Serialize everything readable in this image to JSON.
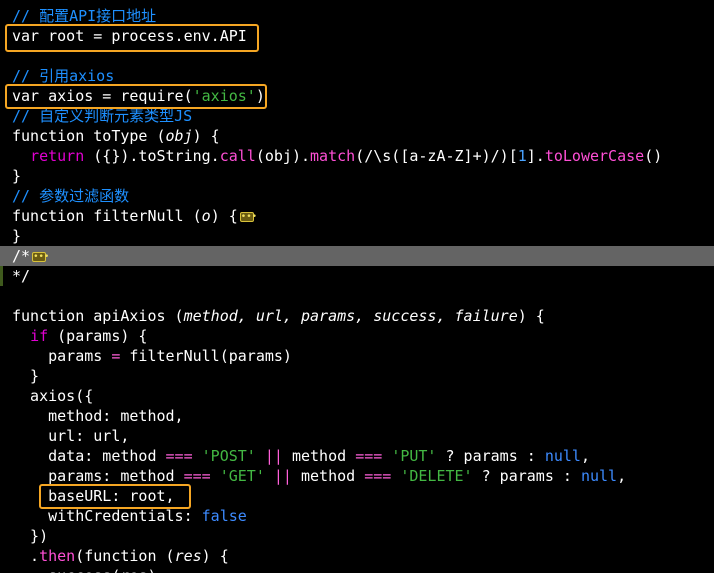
{
  "editor": {
    "lines": [
      {
        "tokens": [
          {
            "t": "// 配置API接口地址",
            "c": "cmt"
          }
        ]
      },
      {
        "tokens": [
          {
            "t": "var root = process.env.API",
            "c": ""
          }
        ]
      },
      {
        "tokens": []
      },
      {
        "tokens": [
          {
            "t": "// 引用axios",
            "c": "cmt"
          }
        ]
      },
      {
        "tokens": [
          {
            "t": "var axios = require(",
            "c": ""
          },
          {
            "t": "'axios'",
            "c": "str"
          },
          {
            "t": ")",
            "c": ""
          }
        ]
      },
      {
        "tokens": [
          {
            "t": "// 自定义判断元素类型JS",
            "c": "cmt"
          }
        ]
      },
      {
        "tokens": [
          {
            "t": "function toType (",
            "c": ""
          },
          {
            "t": "obj",
            "c": "prm"
          },
          {
            "t": ") {",
            "c": ""
          }
        ]
      },
      {
        "tokens": [
          {
            "t": "  ",
            "c": ""
          },
          {
            "t": "return",
            "c": "kw"
          },
          {
            "t": " ({}).toString.",
            "c": ""
          },
          {
            "t": "call",
            "c": "fn"
          },
          {
            "t": "(obj).",
            "c": ""
          },
          {
            "t": "match",
            "c": "fn"
          },
          {
            "t": "(/\\s([a-zA-Z]+)/)[",
            "c": ""
          },
          {
            "t": "1",
            "c": "num"
          },
          {
            "t": "].",
            "c": ""
          },
          {
            "t": "toLowerCase",
            "c": "fn"
          },
          {
            "t": "()",
            "c": ""
          }
        ]
      },
      {
        "tokens": [
          {
            "t": "}",
            "c": ""
          }
        ]
      },
      {
        "tokens": [
          {
            "t": "// 参数过滤函数",
            "c": "cmt"
          }
        ]
      },
      {
        "tokens": [
          {
            "t": "function filterNull (",
            "c": ""
          },
          {
            "t": "o",
            "c": "prm"
          },
          {
            "t": ") {",
            "c": ""
          },
          {
            "t": "fold",
            "c": "fold"
          }
        ]
      },
      {
        "tokens": [
          {
            "t": "}",
            "c": ""
          }
        ]
      },
      {
        "tokens": [
          {
            "t": "/*",
            "c": ""
          },
          {
            "t": "fold",
            "c": "fold"
          }
        ]
      },
      {
        "tokens": [
          {
            "t": "*/",
            "c": ""
          }
        ]
      },
      {
        "tokens": []
      },
      {
        "tokens": [
          {
            "t": "function apiAxios (",
            "c": ""
          },
          {
            "t": "method, url, params, success, failure",
            "c": "prm"
          },
          {
            "t": ") {",
            "c": ""
          }
        ]
      },
      {
        "tokens": [
          {
            "t": "  ",
            "c": ""
          },
          {
            "t": "if",
            "c": "kw"
          },
          {
            "t": " (params) {",
            "c": ""
          }
        ]
      },
      {
        "tokens": [
          {
            "t": "    params ",
            "c": ""
          },
          {
            "t": "=",
            "c": "op"
          },
          {
            "t": " filterNull(params)",
            "c": ""
          }
        ]
      },
      {
        "tokens": [
          {
            "t": "  }",
            "c": ""
          }
        ]
      },
      {
        "tokens": [
          {
            "t": "  axios({",
            "c": ""
          }
        ]
      },
      {
        "tokens": [
          {
            "t": "    method: method,",
            "c": ""
          }
        ]
      },
      {
        "tokens": [
          {
            "t": "    url: url,",
            "c": ""
          }
        ]
      },
      {
        "tokens": [
          {
            "t": "    data: method ",
            "c": ""
          },
          {
            "t": "===",
            "c": "op"
          },
          {
            "t": " ",
            "c": ""
          },
          {
            "t": "'POST'",
            "c": "str"
          },
          {
            "t": " ",
            "c": ""
          },
          {
            "t": "||",
            "c": "op"
          },
          {
            "t": " method ",
            "c": ""
          },
          {
            "t": "===",
            "c": "op"
          },
          {
            "t": " ",
            "c": ""
          },
          {
            "t": "'PUT'",
            "c": "str"
          },
          {
            "t": " ? params : ",
            "c": ""
          },
          {
            "t": "null",
            "c": "nul"
          },
          {
            "t": ",",
            "c": ""
          }
        ]
      },
      {
        "tokens": [
          {
            "t": "    params: method ",
            "c": ""
          },
          {
            "t": "===",
            "c": "op"
          },
          {
            "t": " ",
            "c": ""
          },
          {
            "t": "'GET'",
            "c": "str"
          },
          {
            "t": " ",
            "c": ""
          },
          {
            "t": "||",
            "c": "op"
          },
          {
            "t": " method ",
            "c": ""
          },
          {
            "t": "===",
            "c": "op"
          },
          {
            "t": " ",
            "c": ""
          },
          {
            "t": "'DELETE'",
            "c": "str"
          },
          {
            "t": " ? params : ",
            "c": ""
          },
          {
            "t": "null",
            "c": "nul"
          },
          {
            "t": ",",
            "c": ""
          }
        ]
      },
      {
        "tokens": [
          {
            "t": "    baseURL: root,",
            "c": ""
          }
        ]
      },
      {
        "tokens": [
          {
            "t": "    withCredentials: ",
            "c": ""
          },
          {
            "t": "false",
            "c": "nul"
          }
        ]
      },
      {
        "tokens": [
          {
            "t": "  })",
            "c": ""
          }
        ]
      },
      {
        "tokens": [
          {
            "t": "  .",
            "c": ""
          },
          {
            "t": "then",
            "c": "fn"
          },
          {
            "t": "(function (",
            "c": ""
          },
          {
            "t": "res",
            "c": "prm"
          },
          {
            "t": ") {",
            "c": ""
          }
        ]
      },
      {
        "tokens": [
          {
            "t": "    ",
            "c": ""
          },
          {
            "t": "success",
            "c": ""
          },
          {
            "t": "(",
            "c": ""
          },
          {
            "t": "res",
            "c": ""
          },
          {
            "t": ")",
            "c": ""
          }
        ]
      }
    ]
  },
  "colors": {
    "background": "#000000",
    "comment": "#1e90ff",
    "keyword": "#e000d0",
    "string": "#43b843",
    "number": "#4aa3ff",
    "highlight_box": "#f5a623",
    "selected_line": "#646464"
  }
}
